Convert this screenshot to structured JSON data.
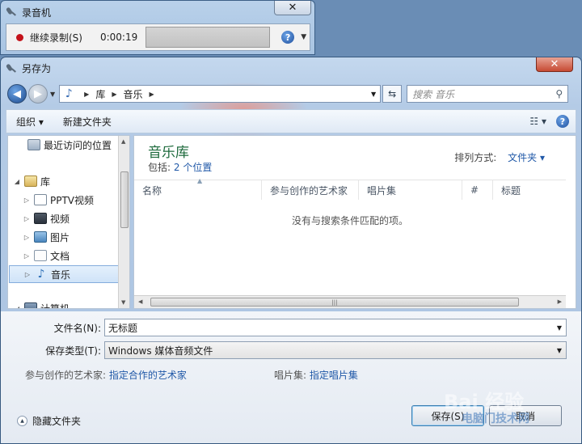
{
  "recorder": {
    "title": "录音机",
    "close": "✕",
    "resume_label": "继续录制(S)",
    "time": "0:00:19",
    "help": "?"
  },
  "dialog": {
    "title": "另存为",
    "close": "✕",
    "breadcrumb": [
      "库",
      "音乐"
    ],
    "search_placeholder": "搜索 音乐",
    "toolbar": {
      "organize": "组织",
      "new_folder": "新建文件夹",
      "help": "?"
    },
    "nav": [
      {
        "label": "最近访问的位置",
        "icon": "recent-places-icon"
      },
      {
        "label": "库",
        "icon": "library-icon"
      },
      {
        "label": "PPTV视频",
        "icon": "pptv-folder-icon"
      },
      {
        "label": "视频",
        "icon": "videos-icon"
      },
      {
        "label": "图片",
        "icon": "pictures-icon"
      },
      {
        "label": "文档",
        "icon": "documents-icon"
      },
      {
        "label": "音乐",
        "icon": "music-icon",
        "selected": true
      },
      {
        "label": "计算机",
        "icon": "computer-icon"
      }
    ],
    "library_title": "音乐库",
    "includes_label": "包括:",
    "includes_link": "2 个位置",
    "arrange_label": "排列方式:",
    "arrange_value": "文件夹",
    "columns": [
      "名称",
      "参与创作的艺术家",
      "唱片集",
      "#",
      "标题"
    ],
    "empty_message": "没有与搜索条件匹配的项。",
    "filename_label": "文件名(N):",
    "filename_value": "无标题",
    "filetype_label": "保存类型(T):",
    "filetype_value": "Windows 媒体音频文件",
    "artist_label": "参与创作的艺术家:",
    "artist_link": "指定合作的艺术家",
    "album_label": "唱片集:",
    "album_link": "指定唱片集",
    "hide_folders": "隐藏文件夹",
    "save_button": "保存(S)",
    "cancel_button": "取消"
  },
  "watermark": {
    "main": "Bai 经验",
    "sub": "电脑门技术网"
  }
}
